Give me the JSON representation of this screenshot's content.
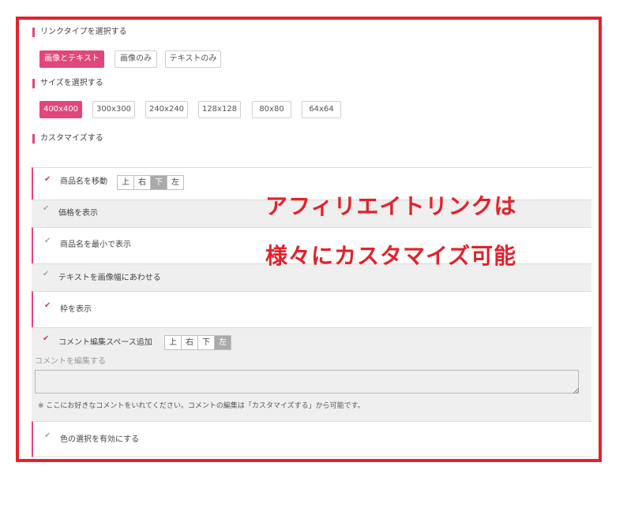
{
  "link_type": {
    "label": "リンクタイプを選択する",
    "options": [
      "画像とテキスト",
      "画像のみ",
      "テキストのみ"
    ]
  },
  "size": {
    "label": "サイズを選択する",
    "options": [
      "400x400",
      "300x300",
      "240x240",
      "128x128",
      "80x80",
      "64x64"
    ]
  },
  "customize": {
    "label": "カスタマイズする",
    "rows": [
      {
        "label": "商品名を移動",
        "checked": true,
        "positions": [
          "上",
          "右",
          "下",
          "左"
        ],
        "selected": "下"
      },
      {
        "label": "価格を表示",
        "checked": false
      },
      {
        "label": "商品名を最小で表示",
        "checked": false
      },
      {
        "label": "テキストを画像幅にあわせる",
        "checked": false
      },
      {
        "label": "枠を表示",
        "checked": true
      },
      {
        "label": "コメント編集スペース追加",
        "checked": true,
        "positions": [
          "上",
          "右",
          "下",
          "左"
        ],
        "selected": "左"
      },
      {
        "label": "色の選択を有効にする",
        "checked": false
      }
    ],
    "comment_label": "コメントを編集する",
    "comment_value": "",
    "comment_note": "※ ここにお好きなコメントをいれてください。コメントの編集は「カスタマイズする」から可能です。"
  },
  "annotation": {
    "line1": "アフィリエイトリンクは",
    "line2": "様々にカスタマイズ可能"
  },
  "colors": {
    "accent": "#e2467a",
    "annotation": "#e3222a",
    "frame": "#e3222a"
  },
  "icons": {
    "check": "check-icon",
    "resize": "resize-grip-icon"
  }
}
